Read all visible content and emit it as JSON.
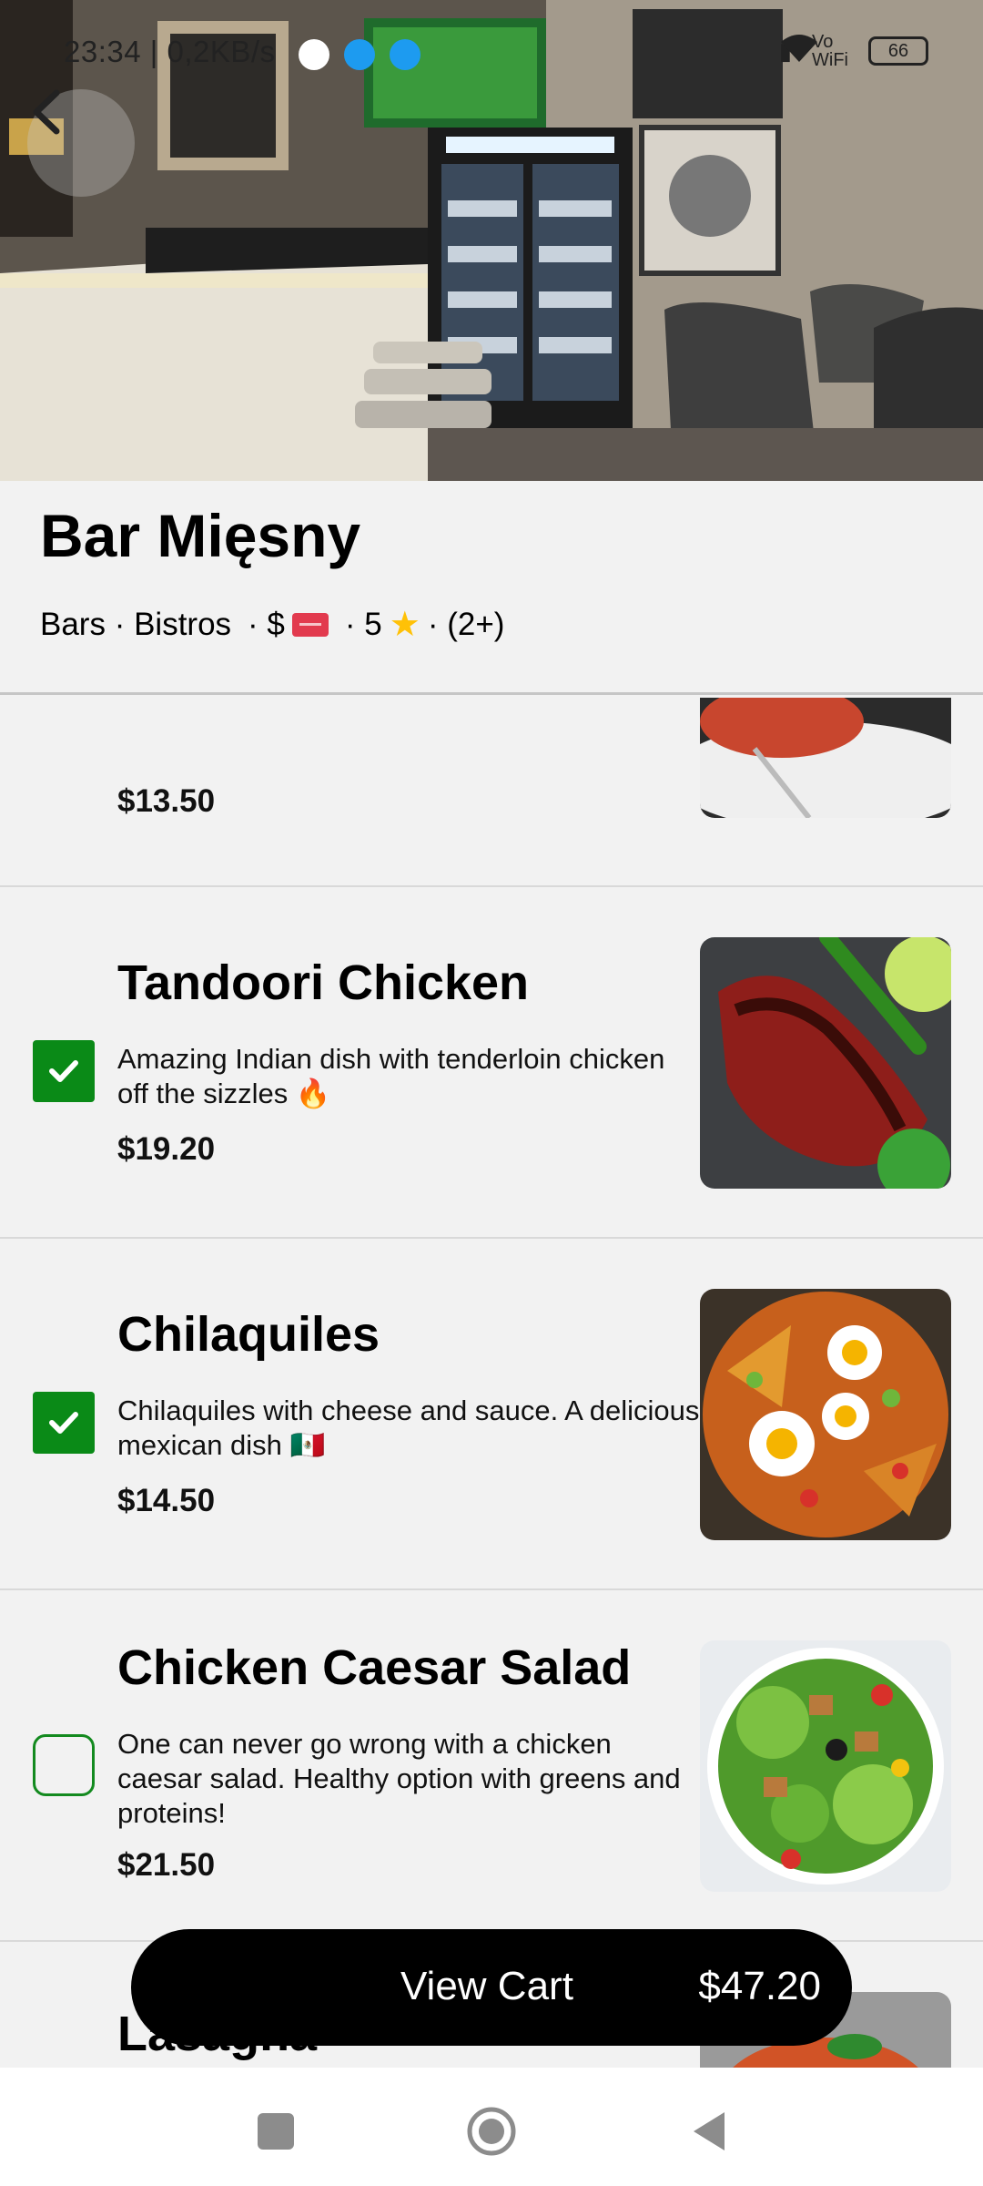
{
  "status_bar": {
    "time_speed": "23:34 | 0,2KB/s",
    "battery": "66",
    "network_label": "Vo WiFi"
  },
  "restaurant": {
    "name": "Bar Mięsny",
    "category": "Bars · Bistros",
    "price_prefix": "· $",
    "rating_prefix": "· 5",
    "reviews": "· (2+)"
  },
  "menu_items": [
    {
      "name": "",
      "description": "",
      "price": "$13.50",
      "selected": null
    },
    {
      "name": "Tandoori Chicken",
      "description": "Amazing Indian dish with tenderloin chicken off the sizzles 🔥",
      "price": "$19.20",
      "selected": true
    },
    {
      "name": "Chilaquiles",
      "description": "Chilaquiles with cheese and sauce. A delicious mexican dish 🇲🇽",
      "price": "$14.50",
      "selected": true
    },
    {
      "name": "Chicken Caesar Salad",
      "description": "One can never go wrong with a chicken caesar salad. Healthy option with greens and proteins!",
      "price": "$21.50",
      "selected": false
    },
    {
      "name": "Lasagna",
      "description": "",
      "price": "",
      "selected": null
    }
  ],
  "cart": {
    "label": "View Cart",
    "total": "$47.20"
  },
  "colors": {
    "check_green": "#0a8a17",
    "cart_bg": "#000000",
    "page_bg": "#f2f2f2"
  },
  "icons": {
    "back": "chevron-left-icon",
    "nav_recents": "square-icon",
    "nav_home": "circle-icon",
    "nav_back": "triangle-left-icon"
  }
}
